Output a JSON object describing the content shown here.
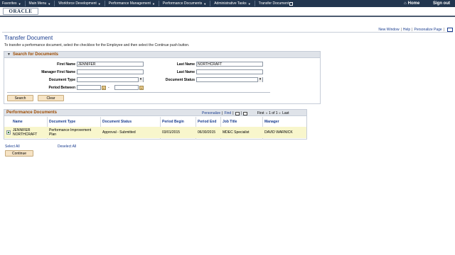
{
  "topnav": {
    "items": [
      {
        "label": "Favorites",
        "arrow": "▼"
      },
      {
        "label": "Main Menu",
        "arrow": "▼"
      },
      {
        "label": "Workforce Development",
        "arrow": "▼"
      },
      {
        "label": "Performance Management",
        "arrow": "▼"
      },
      {
        "label": "Performance Documents",
        "arrow": "▼"
      },
      {
        "label": "Administrative Tasks",
        "arrow": "▼"
      },
      {
        "label": "Transfer Document"
      }
    ],
    "home": "Home",
    "signout": "Sign out"
  },
  "brand": {
    "logo": "ORACLE"
  },
  "toplinks": {
    "new_window": "New Window",
    "help": "Help",
    "personalize": "Personalize Page",
    "sep": "|"
  },
  "page": {
    "title": "Transfer Document",
    "instructions": "To transfer a performance document, select the checkbox for the Employee and then select the Continue push button."
  },
  "search": {
    "header": "Search for Documents",
    "first_name_label": "First Name",
    "first_name_value": "JENNIFER",
    "last_name_label": "Last Name",
    "last_name_value": "NORTHCRAFT",
    "manager_first_name_label": "Manager First Name",
    "manager_first_name_value": "",
    "manager_last_name_label": "Last Name",
    "manager_last_name_value": "",
    "document_type_label": "Document Type",
    "document_type_value": "",
    "document_status_label": "Document Status",
    "document_status_value": "",
    "period_between_label": "Period Between",
    "period_start_value": "",
    "period_end_value": "",
    "dash": "-",
    "search_button": "Search",
    "clear_button": "Clear"
  },
  "grid": {
    "title": "Performance Documents",
    "personalize": "Personalize",
    "find": "Find",
    "sep": "|",
    "first": "First",
    "range": "1 of 1",
    "last": "Last",
    "columns": [
      "Name",
      "Document Type",
      "Document Status",
      "Period Begin",
      "Period End",
      "Job Title",
      "Manager"
    ],
    "rows": [
      {
        "name_line1": "JENNIFER",
        "name_line2": "NORTHCRAFT",
        "doc_type_line1": "Performance Improvement",
        "doc_type_line2": "Plan",
        "status": "Approval - Submitted",
        "period_begin": "03/01/2015",
        "period_end": "06/30/2015",
        "job_title": "MDEC Specialist",
        "manager": "DAVID WARNICK"
      }
    ]
  },
  "actions": {
    "select_all": "Select All",
    "deselect_all": "Deselect All",
    "continue_button": "Continue"
  }
}
